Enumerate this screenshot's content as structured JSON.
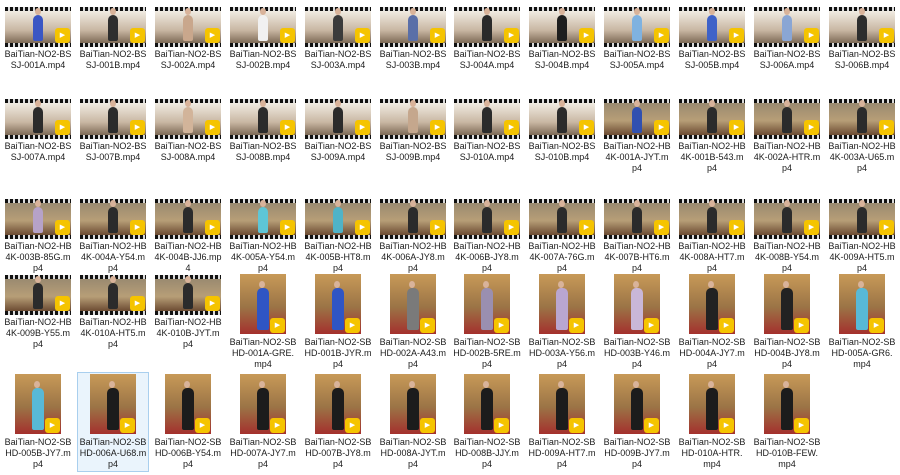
{
  "files": [
    {
      "name": "BaiTian-NO2-BSSJ-001A.mp4",
      "kind": "wide",
      "leg_color": "#3a56c4"
    },
    {
      "name": "BaiTian-NO2-BSSJ-001B.mp4",
      "kind": "wide",
      "leg_color": "#2e2e2e"
    },
    {
      "name": "BaiTian-NO2-BSSJ-002A.mp4",
      "kind": "wide",
      "leg_color": "#c9a78c"
    },
    {
      "name": "BaiTian-NO2-BSSJ-002B.mp4",
      "kind": "wide",
      "leg_color": "#f1f1f1"
    },
    {
      "name": "BaiTian-NO2-BSSJ-003A.mp4",
      "kind": "wide",
      "leg_color": "#3b3b3b"
    },
    {
      "name": "BaiTian-NO2-BSSJ-003B.mp4",
      "kind": "wide",
      "leg_color": "#5a6fa8"
    },
    {
      "name": "BaiTian-NO2-BSSJ-004A.mp4",
      "kind": "wide",
      "leg_color": "#2a2a2a"
    },
    {
      "name": "BaiTian-NO2-BSSJ-004B.mp4",
      "kind": "wide",
      "leg_color": "#1e1e1e"
    },
    {
      "name": "BaiTian-NO2-BSSJ-005A.mp4",
      "kind": "wide",
      "leg_color": "#7fb2e0"
    },
    {
      "name": "BaiTian-NO2-BSSJ-005B.mp4",
      "kind": "wide",
      "leg_color": "#3f62c8"
    },
    {
      "name": "BaiTian-NO2-BSSJ-006A.mp4",
      "kind": "wide",
      "leg_color": "#8aa6d4"
    },
    {
      "name": "BaiTian-NO2-BSSJ-006B.mp4",
      "kind": "wide",
      "leg_color": "#2d2d2d"
    },
    {
      "name": "BaiTian-NO2-BSSJ-007A.mp4",
      "kind": "wide",
      "leg_color": "#2b2b2b"
    },
    {
      "name": "BaiTian-NO2-BSSJ-007B.mp4",
      "kind": "wide",
      "leg_color": "#2b2b2b"
    },
    {
      "name": "BaiTian-NO2-BSSJ-008A.mp4",
      "kind": "wide",
      "leg_color": "#d2b49a"
    },
    {
      "name": "BaiTian-NO2-BSSJ-008B.mp4",
      "kind": "wide",
      "leg_color": "#2b2b2b"
    },
    {
      "name": "BaiTian-NO2-BSSJ-009A.mp4",
      "kind": "wide",
      "leg_color": "#2b2b2b"
    },
    {
      "name": "BaiTian-NO2-BSSJ-009B.mp4",
      "kind": "wide",
      "leg_color": "#c5a78d"
    },
    {
      "name": "BaiTian-NO2-BSSJ-010A.mp4",
      "kind": "wide",
      "leg_color": "#2b2b2b"
    },
    {
      "name": "BaiTian-NO2-BSSJ-010B.mp4",
      "kind": "wide",
      "leg_color": "#2b2b2b"
    },
    {
      "name": "BaiTian-NO2-HB4K-001A-JYT.mp4",
      "kind": "hotel",
      "leg_color": "#3050b0"
    },
    {
      "name": "BaiTian-NO2-HB4K-001B-543.mp4",
      "kind": "hotel",
      "leg_color": "#2b2b2b"
    },
    {
      "name": "BaiTian-NO2-HB4K-002A-HTR.mp4",
      "kind": "hotel",
      "leg_color": "#2b2b2b"
    },
    {
      "name": "BaiTian-NO2-HB4K-003A-U65.mp4",
      "kind": "hotel",
      "leg_color": "#2b2b2b"
    },
    {
      "name": "BaiTian-NO2-HB4K-003B-85G.mp4",
      "kind": "hotel",
      "leg_color": "#b6a2c8"
    },
    {
      "name": "BaiTian-NO2-HB4K-004A-Y54.mp4",
      "kind": "hotel",
      "leg_color": "#2b2b2b"
    },
    {
      "name": "BaiTian-NO2-HB4K-004B-JJ6.mp4",
      "kind": "hotel",
      "leg_color": "#2b2b2b"
    },
    {
      "name": "BaiTian-NO2-HB4K-005A-Y54.mp4",
      "kind": "hotel",
      "leg_color": "#5ec6d6"
    },
    {
      "name": "BaiTian-NO2-HB4K-005B-HT8.mp4",
      "kind": "hotel",
      "leg_color": "#4fb3c7"
    },
    {
      "name": "BaiTian-NO2-HB4K-006A-JY8.mp4",
      "kind": "hotel",
      "leg_color": "#2b2b2b"
    },
    {
      "name": "BaiTian-NO2-HB4K-006B-JY8.mp4",
      "kind": "hotel",
      "leg_color": "#2b2b2b"
    },
    {
      "name": "BaiTian-NO2-HB4K-007A-76G.mp4",
      "kind": "hotel",
      "leg_color": "#2b2b2b"
    },
    {
      "name": "BaiTian-NO2-HB4K-007B-HT6.mp4",
      "kind": "hotel",
      "leg_color": "#2b2b2b"
    },
    {
      "name": "BaiTian-NO2-HB4K-008A-HT7.mp4",
      "kind": "hotel",
      "leg_color": "#2b2b2b"
    },
    {
      "name": "BaiTian-NO2-HB4K-008B-Y54.mp4",
      "kind": "hotel",
      "leg_color": "#2b2b2b"
    },
    {
      "name": "BaiTian-NO2-HB4K-009A-HT5.mp4",
      "kind": "hotel",
      "leg_color": "#2b2b2b"
    },
    {
      "name": "BaiTian-NO2-HB4K-009B-Y55.mp4",
      "kind": "hotel",
      "leg_color": "#2b2b2b"
    },
    {
      "name": "BaiTian-NO2-HB4K-010A-HT5.mp4",
      "kind": "hotel",
      "leg_color": "#2b2b2b"
    },
    {
      "name": "BaiTian-NO2-HB4K-010B-JYT.mp4",
      "kind": "hotel",
      "leg_color": "#2b2b2b"
    },
    {
      "name": "BaiTian-NO2-SBHD-001A-GRE.mp4",
      "kind": "tall",
      "leg_color": "#2f55c4"
    },
    {
      "name": "BaiTian-NO2-SBHD-001B-JYR.mp4",
      "kind": "tall",
      "leg_color": "#2f55c4"
    },
    {
      "name": "BaiTian-NO2-SBHD-002A-A43.mp4",
      "kind": "tall",
      "leg_color": "#7a7a7a"
    },
    {
      "name": "BaiTian-NO2-SBHD-002B-5RE.mp4",
      "kind": "tall",
      "leg_color": "#9a8fb0"
    },
    {
      "name": "BaiTian-NO2-SBHD-003A-Y56.mp4",
      "kind": "tall",
      "leg_color": "#b9a6d0"
    },
    {
      "name": "BaiTian-NO2-SBHD-003B-Y46.mp4",
      "kind": "tall",
      "leg_color": "#c9b7d8"
    },
    {
      "name": "BaiTian-NO2-SBHD-004A-JY7.mp4",
      "kind": "tall",
      "leg_color": "#222222"
    },
    {
      "name": "BaiTian-NO2-SBHD-004B-JY8.mp4",
      "kind": "tall",
      "leg_color": "#222222"
    },
    {
      "name": "BaiTian-NO2-SBHD-005A-GR6.mp4",
      "kind": "tall",
      "leg_color": "#58b9d6"
    },
    {
      "name": "BaiTian-NO2-SBHD-005B-JY7.mp4",
      "kind": "tall",
      "leg_color": "#58b9d6"
    },
    {
      "name": "BaiTian-NO2-SBHD-006A-U68.mp4",
      "kind": "tall",
      "leg_color": "#1c1c1c"
    },
    {
      "name": "BaiTian-NO2-SBHD-006B-Y54.mp4",
      "kind": "tall",
      "leg_color": "#1c1c1c"
    },
    {
      "name": "BaiTian-NO2-SBHD-007A-JY7.mp4",
      "kind": "tall",
      "leg_color": "#1c1c1c"
    },
    {
      "name": "BaiTian-NO2-SBHD-007B-JY8.mp4",
      "kind": "tall",
      "leg_color": "#1c1c1c"
    },
    {
      "name": "BaiTian-NO2-SBHD-008A-JYT.mp4",
      "kind": "tall",
      "leg_color": "#1c1c1c"
    },
    {
      "name": "BaiTian-NO2-SBHD-008B-JJY.mp4",
      "kind": "tall",
      "leg_color": "#1c1c1c"
    },
    {
      "name": "BaiTian-NO2-SBHD-009A-HT7.mp4",
      "kind": "tall",
      "leg_color": "#1c1c1c"
    },
    {
      "name": "BaiTian-NO2-SBHD-009B-JY7.mp4",
      "kind": "tall",
      "leg_color": "#1c1c1c"
    },
    {
      "name": "BaiTian-NO2-SBHD-010A-HTR.mp4",
      "kind": "tall",
      "leg_color": "#1c1c1c"
    },
    {
      "name": "BaiTian-NO2-SBHD-010B-FEW.mp4",
      "kind": "tall",
      "leg_color": "#1c1c1c"
    }
  ],
  "selected_index": 49,
  "player_badge_color": "#f5c400",
  "player_badge_glyph": "▶",
  "player_badge_icon": "media-player-icon"
}
